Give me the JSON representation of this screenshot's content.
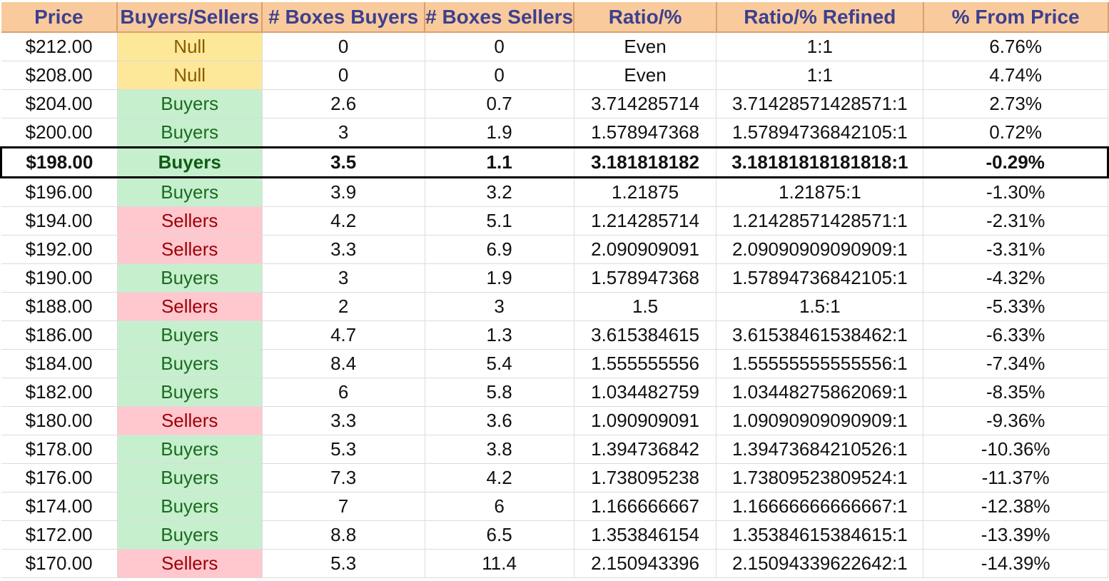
{
  "headers": [
    "Price",
    "Buyers/Sellers",
    "# Boxes Buyers",
    "# Boxes Sellers",
    "Ratio/%",
    "Ratio/% Refined",
    "% From Price"
  ],
  "rows": [
    {
      "price": "$212.00",
      "side": "Null",
      "buyers": "0",
      "sellers": "0",
      "ratio": "Even",
      "refined": "1:1",
      "from_price": "6.76%",
      "current": false
    },
    {
      "price": "$208.00",
      "side": "Null",
      "buyers": "0",
      "sellers": "0",
      "ratio": "Even",
      "refined": "1:1",
      "from_price": "4.74%",
      "current": false
    },
    {
      "price": "$204.00",
      "side": "Buyers",
      "buyers": "2.6",
      "sellers": "0.7",
      "ratio": "3.714285714",
      "refined": "3.71428571428571:1",
      "from_price": "2.73%",
      "current": false
    },
    {
      "price": "$200.00",
      "side": "Buyers",
      "buyers": "3",
      "sellers": "1.9",
      "ratio": "1.578947368",
      "refined": "1.57894736842105:1",
      "from_price": "0.72%",
      "current": false
    },
    {
      "price": "$198.00",
      "side": "Buyers",
      "buyers": "3.5",
      "sellers": "1.1",
      "ratio": "3.181818182",
      "refined": "3.18181818181818:1",
      "from_price": "-0.29%",
      "current": true
    },
    {
      "price": "$196.00",
      "side": "Buyers",
      "buyers": "3.9",
      "sellers": "3.2",
      "ratio": "1.21875",
      "refined": "1.21875:1",
      "from_price": "-1.30%",
      "current": false
    },
    {
      "price": "$194.00",
      "side": "Sellers",
      "buyers": "4.2",
      "sellers": "5.1",
      "ratio": "1.214285714",
      "refined": "1.21428571428571:1",
      "from_price": "-2.31%",
      "current": false
    },
    {
      "price": "$192.00",
      "side": "Sellers",
      "buyers": "3.3",
      "sellers": "6.9",
      "ratio": "2.090909091",
      "refined": "2.09090909090909:1",
      "from_price": "-3.31%",
      "current": false
    },
    {
      "price": "$190.00",
      "side": "Buyers",
      "buyers": "3",
      "sellers": "1.9",
      "ratio": "1.578947368",
      "refined": "1.57894736842105:1",
      "from_price": "-4.32%",
      "current": false
    },
    {
      "price": "$188.00",
      "side": "Sellers",
      "buyers": "2",
      "sellers": "3",
      "ratio": "1.5",
      "refined": "1.5:1",
      "from_price": "-5.33%",
      "current": false
    },
    {
      "price": "$186.00",
      "side": "Buyers",
      "buyers": "4.7",
      "sellers": "1.3",
      "ratio": "3.615384615",
      "refined": "3.61538461538462:1",
      "from_price": "-6.33%",
      "current": false
    },
    {
      "price": "$184.00",
      "side": "Buyers",
      "buyers": "8.4",
      "sellers": "5.4",
      "ratio": "1.555555556",
      "refined": "1.55555555555556:1",
      "from_price": "-7.34%",
      "current": false
    },
    {
      "price": "$182.00",
      "side": "Buyers",
      "buyers": "6",
      "sellers": "5.8",
      "ratio": "1.034482759",
      "refined": "1.03448275862069:1",
      "from_price": "-8.35%",
      "current": false
    },
    {
      "price": "$180.00",
      "side": "Sellers",
      "buyers": "3.3",
      "sellers": "3.6",
      "ratio": "1.090909091",
      "refined": "1.09090909090909:1",
      "from_price": "-9.36%",
      "current": false
    },
    {
      "price": "$178.00",
      "side": "Buyers",
      "buyers": "5.3",
      "sellers": "3.8",
      "ratio": "1.394736842",
      "refined": "1.39473684210526:1",
      "from_price": "-10.36%",
      "current": false
    },
    {
      "price": "$176.00",
      "side": "Buyers",
      "buyers": "7.3",
      "sellers": "4.2",
      "ratio": "1.738095238",
      "refined": "1.73809523809524:1",
      "from_price": "-11.37%",
      "current": false
    },
    {
      "price": "$174.00",
      "side": "Buyers",
      "buyers": "7",
      "sellers": "6",
      "ratio": "1.166666667",
      "refined": "1.16666666666667:1",
      "from_price": "-12.38%",
      "current": false
    },
    {
      "price": "$172.00",
      "side": "Buyers",
      "buyers": "8.8",
      "sellers": "6.5",
      "ratio": "1.353846154",
      "refined": "1.35384615384615:1",
      "from_price": "-13.39%",
      "current": false
    },
    {
      "price": "$170.00",
      "side": "Sellers",
      "buyers": "5.3",
      "sellers": "11.4",
      "ratio": "2.150943396",
      "refined": "2.15094339622642:1",
      "from_price": "-14.39%",
      "current": false
    }
  ],
  "colors": {
    "header_bg": "#f9cb9c",
    "header_text": "#3d3f8f",
    "null_bg": "#fde89a",
    "null_text": "#8a5a00",
    "buyers_bg": "#c6efce",
    "buyers_text": "#1a6b1f",
    "sellers_bg": "#ffc7ce",
    "sellers_text": "#9c0006"
  }
}
